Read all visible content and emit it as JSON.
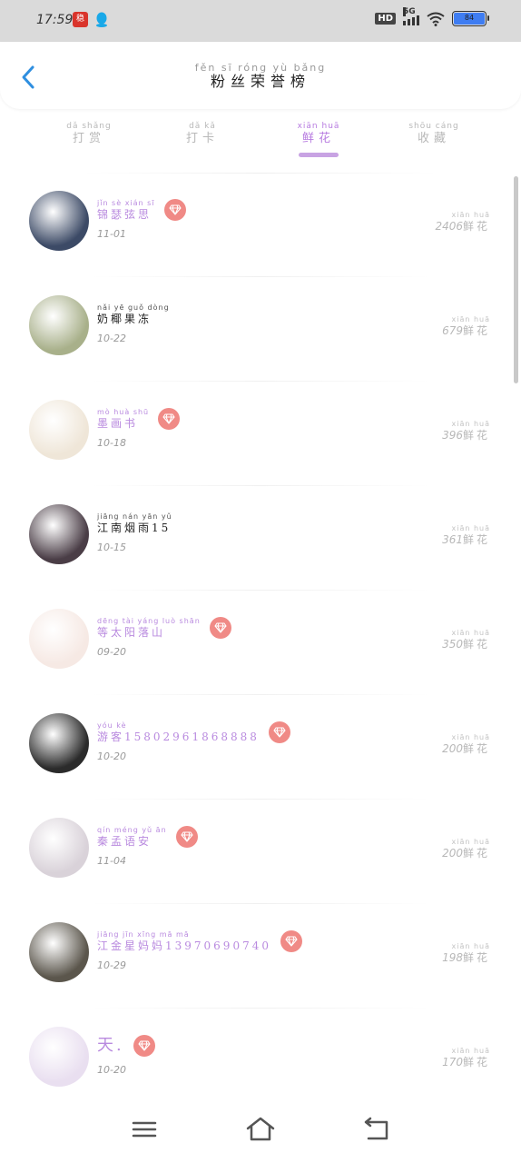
{
  "status": {
    "time": "17:59",
    "app_icon_text": "稳",
    "hd": "HD",
    "network": "5G",
    "battery": "84"
  },
  "header": {
    "title_pinyin": "fěn sī róng yù bǎng",
    "title": "粉丝荣誉榜"
  },
  "tabs": [
    {
      "pinyin": "dǎ shǎng",
      "label": "打赏",
      "active": false
    },
    {
      "pinyin": "dǎ kǎ",
      "label": "打卡",
      "active": false
    },
    {
      "pinyin": "xiān huā",
      "label": "鲜花",
      "active": true
    },
    {
      "pinyin": "shōu cáng",
      "label": "收藏",
      "active": false
    }
  ],
  "list": [
    {
      "pinyin": "jǐn sè xián sī",
      "name": "锦瑟弦思",
      "vip": true,
      "style": "purple",
      "date": "11-01",
      "unit_pinyin": "xiān huā",
      "count": "2406",
      "unit": "鲜花",
      "avatar": "#3c4a66"
    },
    {
      "pinyin": "nǎi yē guǒ dòng",
      "name": "奶椰果冻",
      "vip": false,
      "style": "dark",
      "date": "10-22",
      "unit_pinyin": "xiān huā",
      "count": "679",
      "unit": "鲜花",
      "avatar": "#a8b08a"
    },
    {
      "pinyin": "mò huà shū",
      "name": "墨画书",
      "vip": true,
      "style": "purple",
      "date": "10-18",
      "unit_pinyin": "xiān huā",
      "count": "396",
      "unit": "鲜花",
      "avatar": "#efe6d8"
    },
    {
      "pinyin": "jiāng nán yān yǔ",
      "name": "江南烟雨15",
      "vip": false,
      "style": "dark",
      "date": "10-15",
      "unit_pinyin": "xiān huā",
      "count": "361",
      "unit": "鲜花",
      "avatar": "#4a3d46"
    },
    {
      "pinyin": "dēng tài yáng luò shān",
      "name": "等太阳落山",
      "vip": true,
      "style": "purple",
      "date": "09-20",
      "unit_pinyin": "xiān huā",
      "count": "350",
      "unit": "鲜花",
      "avatar": "#f6e9e4"
    },
    {
      "pinyin": "yóu kè",
      "name": "游客15802961868888",
      "vip": true,
      "style": "purple",
      "date": "10-20",
      "unit_pinyin": "xiān huā",
      "count": "200",
      "unit": "鲜花",
      "avatar": "#2b2b2b"
    },
    {
      "pinyin": "qín méng yǔ ān",
      "name": "秦孟语安",
      "vip": true,
      "style": "purple",
      "date": "11-04",
      "unit_pinyin": "xiān huā",
      "count": "200",
      "unit": "鲜花",
      "avatar": "#d9d2d9"
    },
    {
      "pinyin": "jiāng jīn xīng mā mā",
      "name": "江金星妈妈13970690740",
      "vip": true,
      "style": "purple",
      "date": "10-29",
      "unit_pinyin": "xiān huā",
      "count": "198",
      "unit": "鲜花",
      "avatar": "#5b564c"
    },
    {
      "pinyin": "",
      "name": "天.",
      "vip": true,
      "style": "purple-big",
      "date": "10-20",
      "unit_pinyin": "xiān huā",
      "count": "170",
      "unit": "鲜花",
      "avatar": "#e9dff0"
    }
  ],
  "colors": {
    "accent": "#b77be0",
    "vip_badge": "#f08a86",
    "back_arrow": "#2f8fe0"
  },
  "icons": {
    "back": "chevron-left-icon",
    "vip": "diamond-icon",
    "nav_menu": "menu-icon",
    "nav_home": "home-icon",
    "nav_back": "return-icon"
  }
}
